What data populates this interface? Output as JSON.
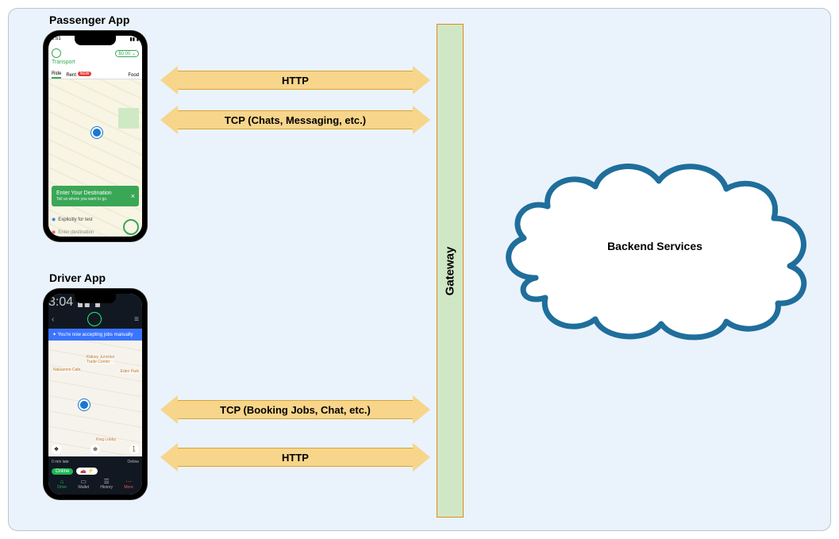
{
  "titles": {
    "passenger": "Passenger App",
    "driver": "Driver App"
  },
  "arrows": {
    "pax_http": "HTTP",
    "pax_tcp": "TCP (Chats, Messaging, etc.)",
    "drv_tcp": "TCP (Booking Jobs, Chat, etc.)",
    "drv_http": "HTTP"
  },
  "gateway": "Gateway",
  "backend": "Backend Services",
  "passenger_screen": {
    "time": "2:51",
    "balance": "$0.00",
    "header": "Transport",
    "tab_ride": "Ride",
    "tab_rent": "Rent",
    "tab_rent_badge": "NEW",
    "tab_food": "Food",
    "dest_title": "Enter Your Destination",
    "dest_sub": "Tell us where you want to go.",
    "recent": "Explicitly for test",
    "entry": "Enter destination"
  },
  "driver_screen": {
    "time": "3:04",
    "banner": "You're now accepting jobs manually",
    "bar_late": "0 min late",
    "bar_online": "Online",
    "pill_online": "Online",
    "pill_auto": "🚗 ⚡",
    "nav_drive": "Drive",
    "nav_wallet": "Wallet",
    "nav_history": "History",
    "nav_more": "More"
  }
}
